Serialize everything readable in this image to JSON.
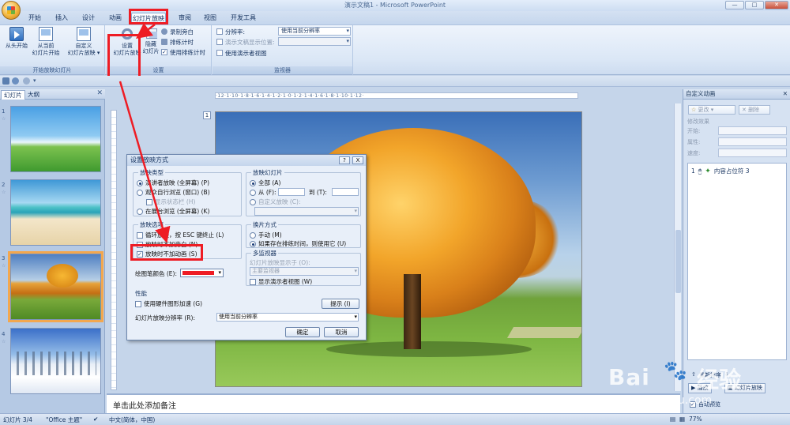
{
  "window": {
    "title": "演示文稿1 - Microsoft PowerPoint",
    "controls": [
      "—",
      "□",
      "✕"
    ]
  },
  "tabs": [
    {
      "label": "开始"
    },
    {
      "label": "插入"
    },
    {
      "label": "设计"
    },
    {
      "label": "动画"
    },
    {
      "label": "幻灯片放映",
      "active": true
    },
    {
      "label": "审阅"
    },
    {
      "label": "视图"
    },
    {
      "label": "开发工具"
    }
  ],
  "ribbon": {
    "start_group": {
      "label": "开始放映幻灯片",
      "from_start": "从头开始",
      "from_current_1": "从当前",
      "from_current_2": "幻灯片开始",
      "custom_1": "自定义",
      "custom_2": "幻灯片放映 ▾"
    },
    "setup_group": {
      "label": "设置",
      "setup_1": "设置",
      "setup_2": "幻灯片放映",
      "hide_1": "隐藏",
      "hide_2": "幻灯片",
      "record": "录制旁白",
      "rehearse": "排练计时",
      "use_timings": "使用排练计时"
    },
    "monitor_group": {
      "label": "监视器",
      "resolution_label": "分辨率:",
      "resolution_value": "使用当前分辨率",
      "show_on_label": "演示文稿显示位置:",
      "presenter_view": "使用演示者视图"
    }
  },
  "left_panel": {
    "tab_slides": "幻灯片",
    "tab_outline": "大纲",
    "close": "✕",
    "slides": [
      {
        "num": "1"
      },
      {
        "num": "2"
      },
      {
        "num": "3",
        "selected": true
      },
      {
        "num": "4"
      }
    ]
  },
  "slide_area": {
    "ruler": "·12·1·10·1·8·1·6·1·4·1·2·1·0·1·2·1·4·1·6·1·8·1·10·1·12·",
    "slide_number": "1",
    "notes_placeholder": "单击此处添加备注"
  },
  "right_pane": {
    "title": "自定义动画",
    "close": "✕",
    "change_btn": "更改",
    "delete_btn": "删除",
    "modify_label": "修改效果",
    "start_label": "开始:",
    "property_label": "属性:",
    "speed_label": "速度:",
    "list_item_index": "1",
    "list_item_label": "内容占位符 3",
    "reorder_label": "重新排序",
    "play_btn": "播放",
    "slideshow_btn": "幻灯片放映",
    "autopreview": "自动预览"
  },
  "dialog": {
    "title": "设置放映方式",
    "help": "?",
    "close": "X",
    "show_type": {
      "legend": "放映类型",
      "opt1": "演讲者放映 (全屏幕) (P)",
      "opt2": "观众自行浏览 (窗口) (B)",
      "opt2_sub": "显示状态栏 (H)",
      "opt3": "在展台浏览 (全屏幕) (K)"
    },
    "show_slides": {
      "legend": "放映幻灯片",
      "all": "全部 (A)",
      "from": "从 (F):",
      "to": "到 (T):",
      "custom": "自定义放映 (C):"
    },
    "show_options": {
      "legend": "放映选项",
      "loop": "循环放映，按 ESC 键终止 (L)",
      "no_narration": "放映时不加旁白 (N)",
      "no_animation": "放映时不加动画 (S)"
    },
    "advance": {
      "legend": "换片方式",
      "manual": "手动 (M)",
      "timings": "如果存在排练时间，则使用它 (U)"
    },
    "multi_monitor": {
      "legend": "多监视器",
      "display_on": "幻灯片放映显示于 (O):",
      "monitor_value": "主要监视器",
      "presenter_view": "显示演示者视图 (W)"
    },
    "pen_color_label": "绘图笔颜色 (E):",
    "pen_color": "#ee1c24",
    "performance": {
      "legend": "性能",
      "hw_accel": "使用硬件图形加速 (G)",
      "tips": "提示 (I)",
      "resolution_label": "幻灯片放映分辨率 (R):",
      "resolution_value": "使用当前分辨率"
    },
    "ok": "确定",
    "cancel": "取消"
  },
  "statusbar": {
    "slide_info": "幻灯片 3/4",
    "theme": "\"Office 主题\"",
    "language": "中文(简体，中国)",
    "zoom": "77%"
  },
  "watermark": {
    "brand": "Bai",
    "paw": "🐾",
    "cn": "经验",
    "url": "jingyan.baidu.com"
  }
}
